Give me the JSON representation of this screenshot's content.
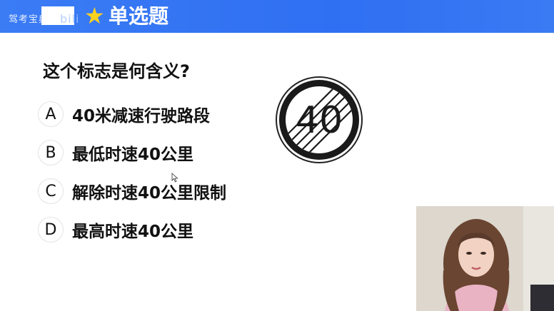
{
  "header": {
    "brand": "驾考宝典",
    "watermark": "bili",
    "title": "单选题",
    "bg_color": "#3174f2",
    "star_color": "#ffd21f"
  },
  "question": {
    "text": "这个标志是何含义?",
    "sign_value": "40"
  },
  "options": [
    {
      "letter": "A",
      "text": "40米减速行驶路段"
    },
    {
      "letter": "B",
      "text": "最低时速40公里"
    },
    {
      "letter": "C",
      "text": "解除时速40公里限制"
    },
    {
      "letter": "D",
      "text": "最高时速40公里"
    }
  ]
}
